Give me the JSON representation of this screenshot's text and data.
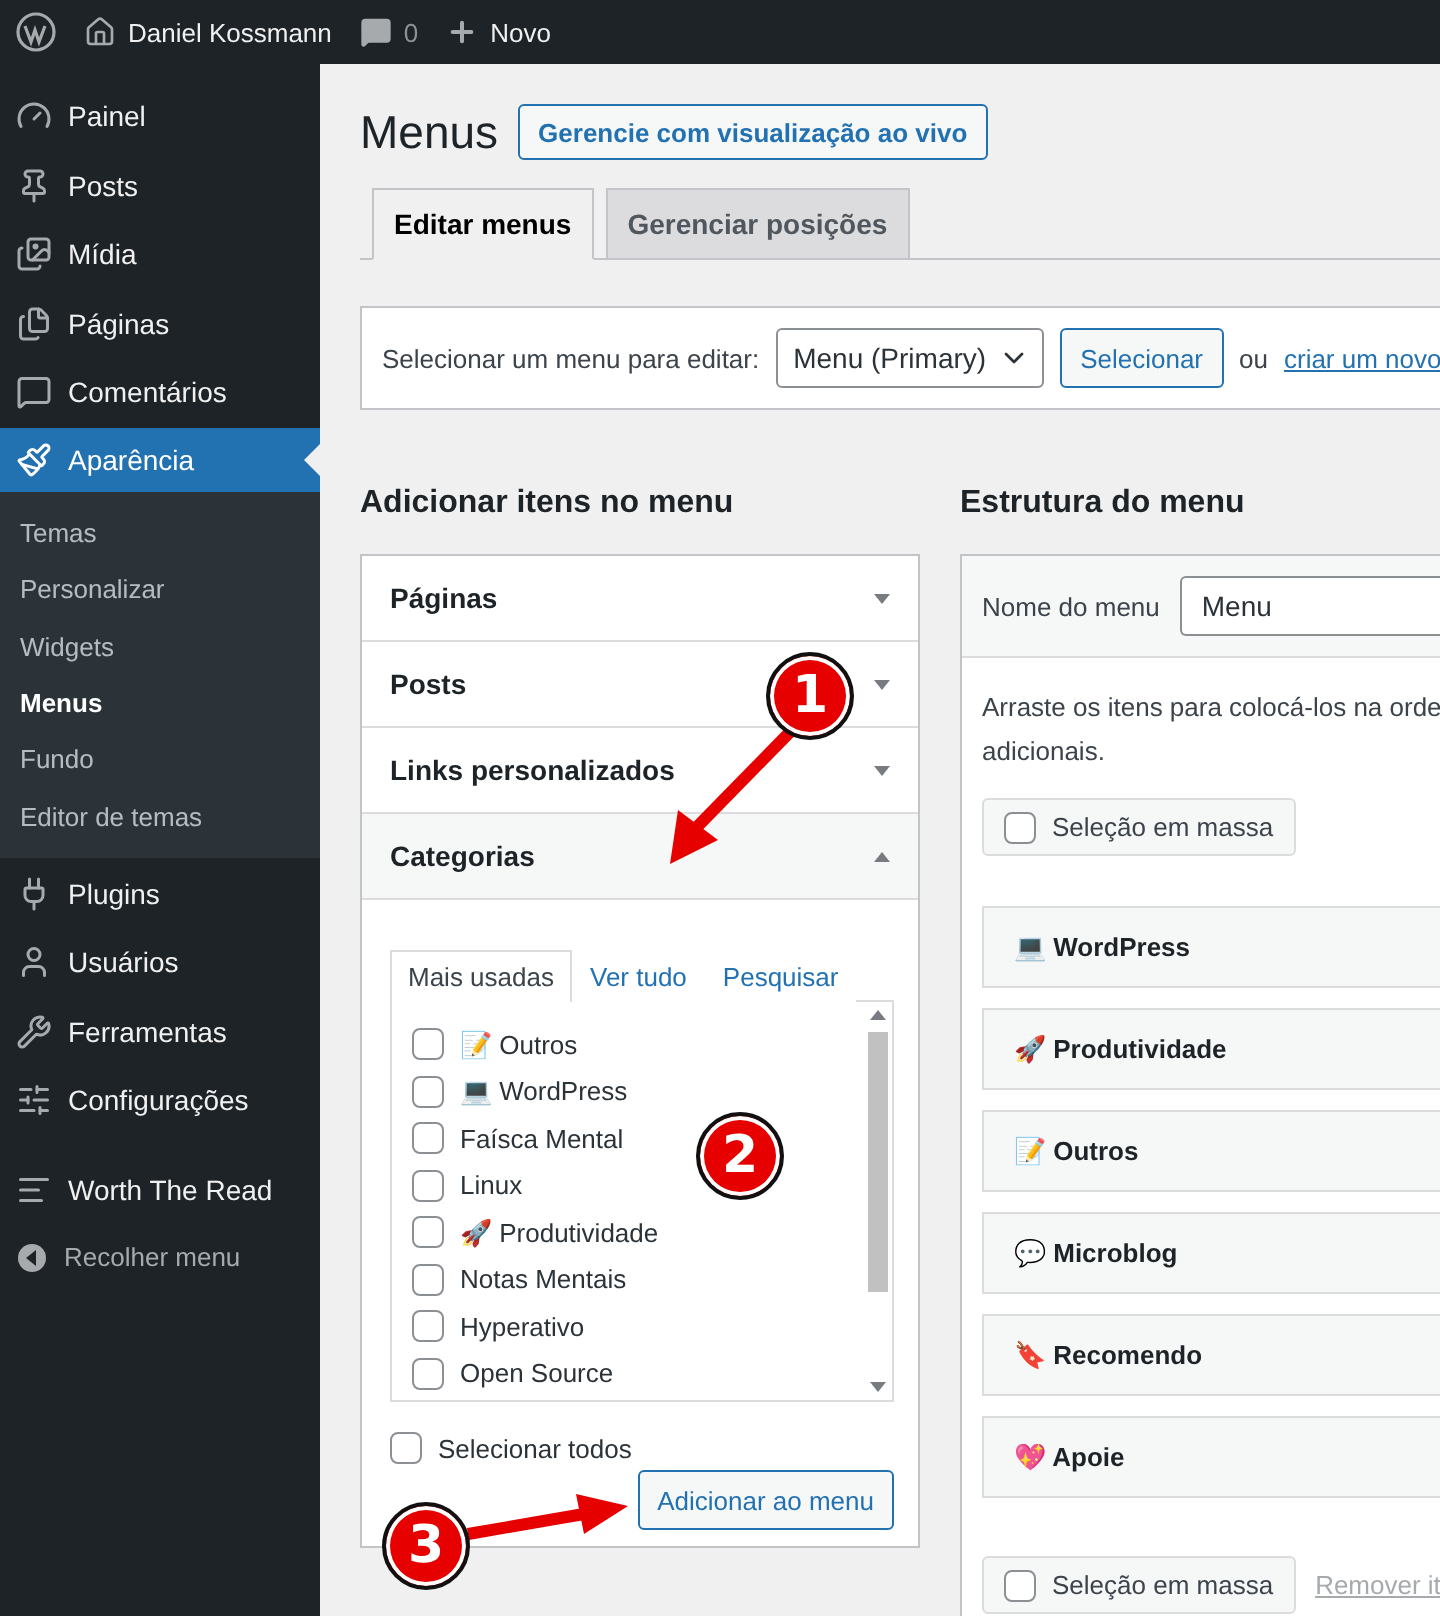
{
  "admin_bar": {
    "site": "Daniel Kossmann",
    "comments": "0",
    "new": "Novo"
  },
  "sidebar": {
    "items": [
      {
        "label": "Painel",
        "selected": false
      },
      {
        "label": "Posts",
        "selected": false
      },
      {
        "label": "Mídia",
        "selected": false
      },
      {
        "label": "Páginas",
        "selected": false
      },
      {
        "label": "Comentários",
        "selected": false
      },
      {
        "label": "Aparência",
        "selected": true,
        "children": [
          {
            "label": "Temas",
            "selected": false
          },
          {
            "label": "Personalizar",
            "selected": false
          },
          {
            "label": "Widgets",
            "selected": false
          },
          {
            "label": "Menus",
            "selected": true
          },
          {
            "label": "Fundo",
            "selected": false
          },
          {
            "label": "Editor de temas",
            "selected": false
          }
        ]
      },
      {
        "label": "Plugins",
        "selected": false
      },
      {
        "label": "Usuários",
        "selected": false
      },
      {
        "label": "Ferramentas",
        "selected": false
      },
      {
        "label": "Configurações",
        "selected": false
      },
      {
        "label": "Worth The Read",
        "selected": false
      }
    ],
    "collapse": "Recolher menu"
  },
  "page": {
    "title": "Menus",
    "live_button": "Gerencie com visualização ao vivo",
    "tabs": [
      {
        "label": "Editar menus",
        "selected": true
      },
      {
        "label": "Gerenciar posições",
        "selected": false
      }
    ],
    "select_bar": {
      "label": "Selecionar um menu para editar:",
      "value": "Menu (Primary)",
      "button": "Selecionar",
      "or_text": "ou",
      "link": "criar um novo"
    }
  },
  "add_items": {
    "heading": "Adicionar itens no menu",
    "sections": [
      {
        "label": "Páginas",
        "expanded": false
      },
      {
        "label": "Posts",
        "expanded": false
      },
      {
        "label": "Links personalizados",
        "expanded": false
      },
      {
        "label": "Categorias",
        "expanded": true
      }
    ],
    "tabs": [
      {
        "label": "Mais usadas",
        "selected": true
      },
      {
        "label": "Ver tudo",
        "selected": false
      },
      {
        "label": "Pesquisar",
        "selected": false
      }
    ],
    "categories": [
      {
        "label": "📝 Outros",
        "checked": false
      },
      {
        "label": "💻 WordPress",
        "checked": false
      },
      {
        "label": "Faísca Mental",
        "checked": false
      },
      {
        "label": "Linux",
        "checked": false
      },
      {
        "label": "🚀 Produtividade",
        "checked": false
      },
      {
        "label": "Notas Mentais",
        "checked": false
      },
      {
        "label": "Hyperativo",
        "checked": false
      },
      {
        "label": "Open Source",
        "checked": false
      }
    ],
    "select_all": {
      "label": "Selecionar todos",
      "checked": false
    },
    "add_button": "Adicionar ao menu"
  },
  "structure": {
    "heading": "Estrutura do menu",
    "name_label": "Nome do menu",
    "name_value": "Menu",
    "instructions": [
      "Arraste os itens para colocá-los na orde",
      "adicionais."
    ],
    "bulk_top": {
      "label": "Seleção em massa",
      "checked": false
    },
    "items": [
      {
        "label": "💻 WordPress"
      },
      {
        "label": "🚀 Produtividade"
      },
      {
        "label": "📝 Outros"
      },
      {
        "label": "💬 Microblog"
      },
      {
        "label": "🔖 Recomendo"
      },
      {
        "label": "💖 Apoie"
      }
    ],
    "bulk_bottom": {
      "label": "Seleção em massa",
      "checked": false
    },
    "remove_link": "Remover it"
  },
  "annotations": [
    {
      "label": "1"
    },
    {
      "label": "2"
    },
    {
      "label": "3"
    }
  ]
}
